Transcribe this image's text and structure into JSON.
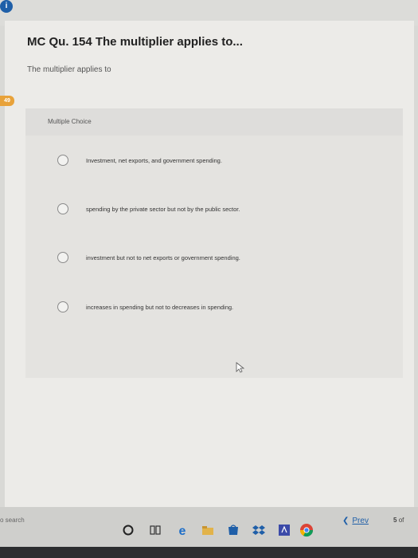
{
  "question": {
    "title": "MC Qu. 154 The multiplier applies to...",
    "prompt": "The multiplier applies to",
    "badge": "49",
    "type_label": "Multiple Choice",
    "options": [
      {
        "label": "Investment, net exports, and government spending."
      },
      {
        "label": "spending by the private sector but not by the public sector."
      },
      {
        "label": "investment but not to net exports or government spending."
      },
      {
        "label": "increases in spending but not to decreases in spending."
      }
    ]
  },
  "nav": {
    "prev_label": "Prev",
    "page_current": "5",
    "page_of": "of"
  },
  "taskbar": {
    "search_label": "o search"
  },
  "info_icon": "i",
  "colors": {
    "accent": "#1f5fa8",
    "badge": "#e8a23a",
    "page_bg": "#ecebe8"
  }
}
